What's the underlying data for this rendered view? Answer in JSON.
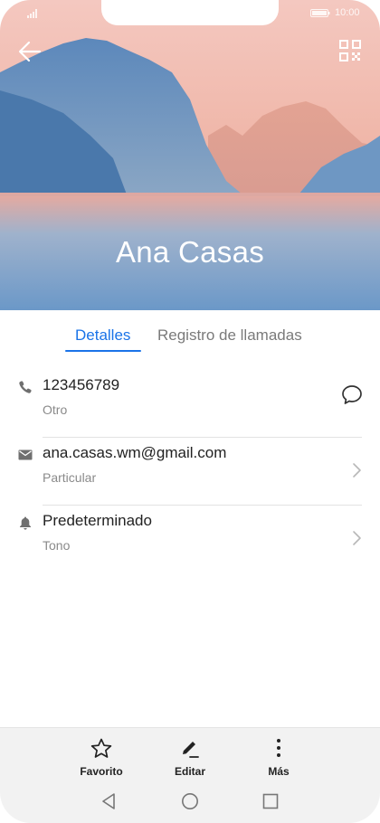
{
  "status_bar": {
    "time": "10:00"
  },
  "contact": {
    "name": "Ana Casas"
  },
  "tabs": [
    {
      "label": "Detalles",
      "active": true
    },
    {
      "label": "Registro de llamadas",
      "active": false
    }
  ],
  "details": [
    {
      "primary": "123456789",
      "secondary": "Otro",
      "icon": "phone-icon",
      "action": "message-icon"
    },
    {
      "primary": "ana.casas.wm@gmail.com",
      "secondary": "Particular",
      "icon": "email-icon",
      "action": "chevron-right-icon"
    },
    {
      "primary": "Predeterminado",
      "secondary": "Tono",
      "icon": "bell-icon",
      "action": "chevron-right-icon"
    }
  ],
  "actions": [
    {
      "label": "Favorito",
      "icon": "star-icon"
    },
    {
      "label": "Editar",
      "icon": "pencil-icon"
    },
    {
      "label": "Más",
      "icon": "more-vertical-icon"
    }
  ],
  "navigation": [
    "back-icon",
    "home-icon",
    "recents-icon"
  ],
  "colors": {
    "accent": "#1a73e8",
    "action_bar": "#f2f2f2",
    "hero_sky": "#f0b7ab",
    "hero_mountain": "#4d7fb4"
  }
}
